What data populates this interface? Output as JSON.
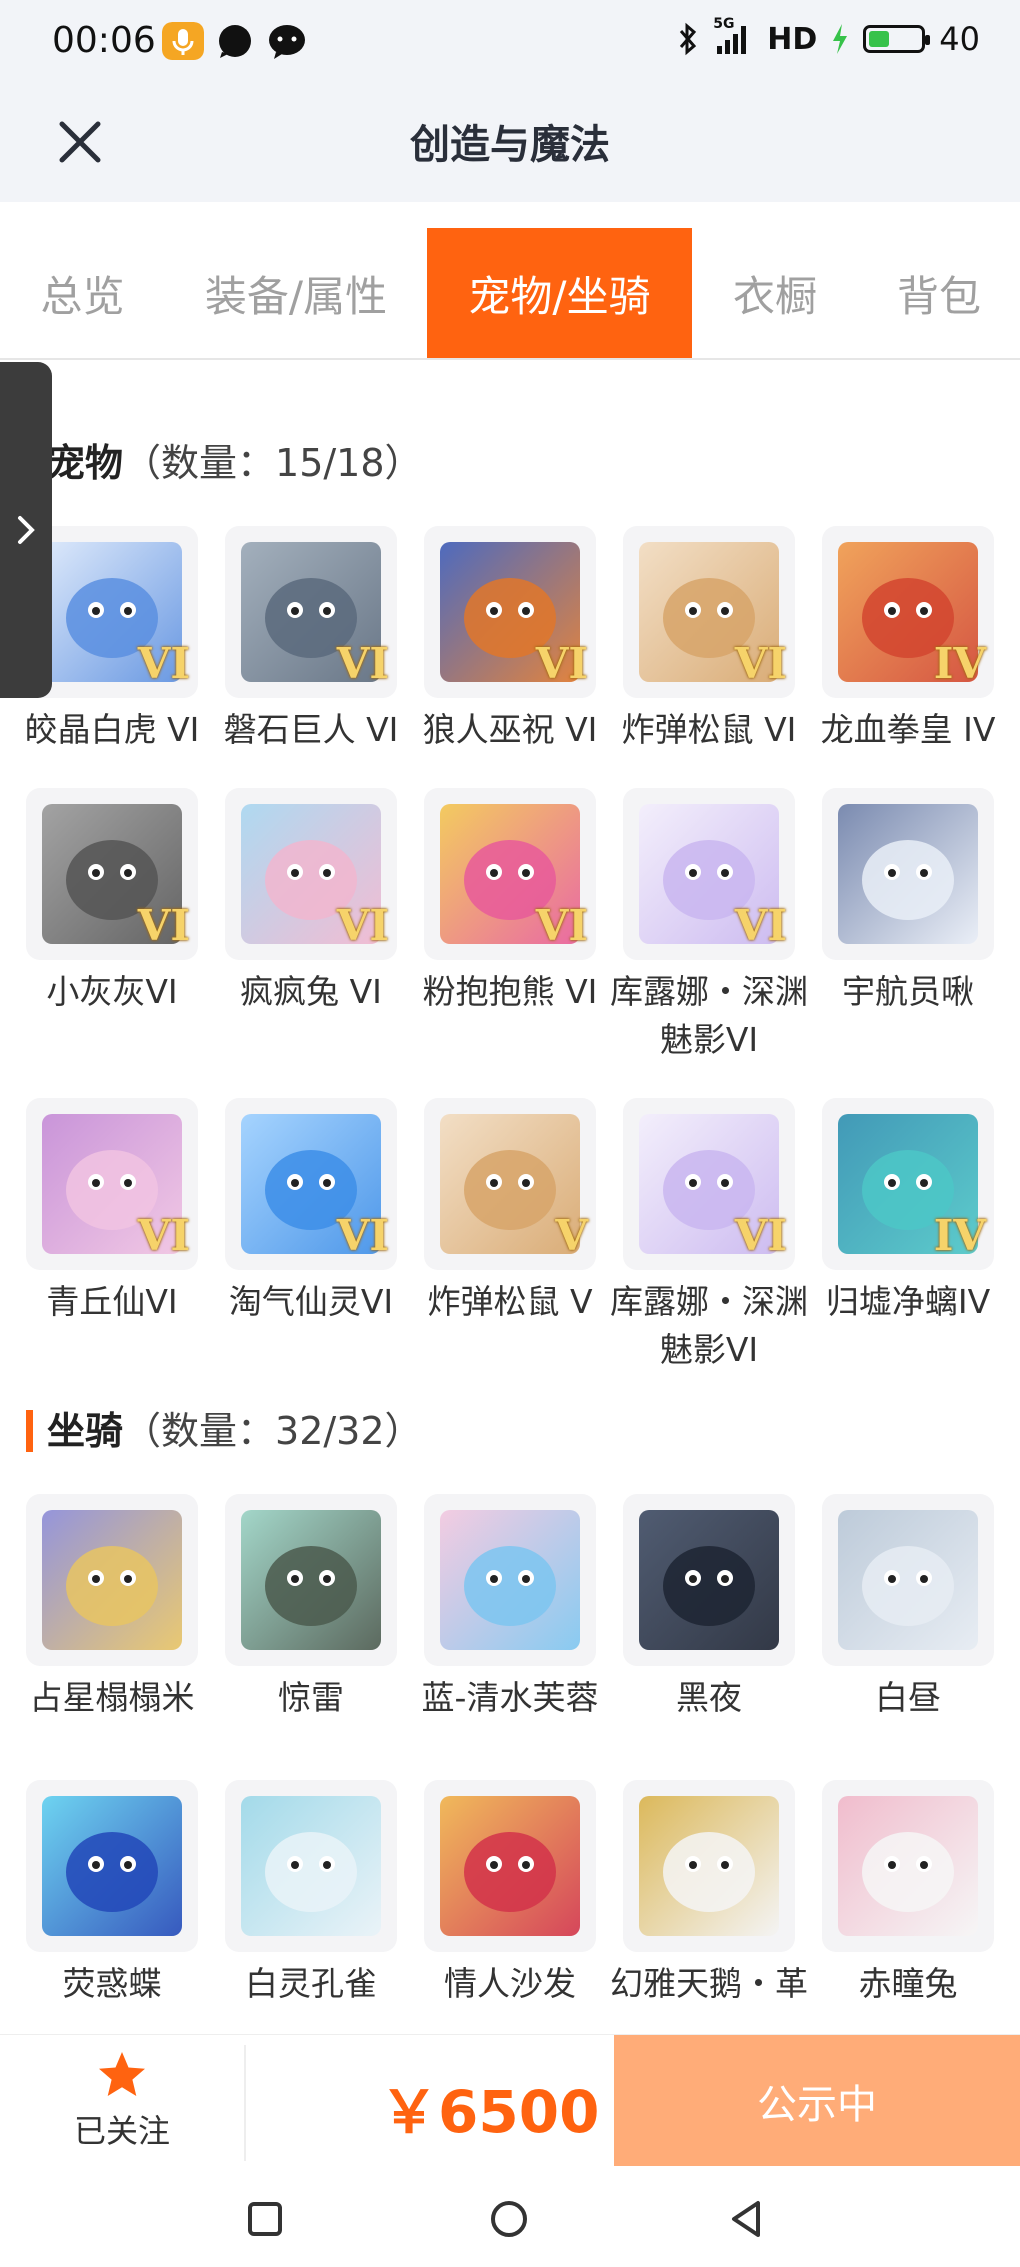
{
  "status_bar": {
    "time": "00:06",
    "network": "5G",
    "hd": "HD",
    "battery": "40",
    "battery_level": 0.4
  },
  "header": {
    "title": "创造与魔法"
  },
  "tabs": [
    {
      "label": "总览",
      "active": false
    },
    {
      "label": "装备/属性",
      "active": false
    },
    {
      "label": "宠物/坐骑",
      "active": true
    },
    {
      "label": "衣橱",
      "active": false
    },
    {
      "label": "背包",
      "active": false
    }
  ],
  "pets": {
    "title": "宠物",
    "count": "（数量：15/18）",
    "items": [
      {
        "name": "皎晶白虎 VI",
        "badge": "VI"
      },
      {
        "name": "磐石巨人 VI",
        "badge": "VI"
      },
      {
        "name": "狼人巫祝 VI",
        "badge": "VI"
      },
      {
        "name": "炸弹松鼠 VI",
        "badge": "VI"
      },
      {
        "name": "龙血拳皇 IV",
        "badge": "IV"
      },
      {
        "name": "小灰灰VI",
        "badge": "VI"
      },
      {
        "name": "疯疯兔 VI",
        "badge": "VI"
      },
      {
        "name": "粉抱抱熊 VI",
        "badge": "VI"
      },
      {
        "name": "库露娜・深渊魅影VI",
        "badge": "VI"
      },
      {
        "name": "宇航员啾",
        "badge": ""
      },
      {
        "name": "青丘仙VI",
        "badge": "VI"
      },
      {
        "name": "淘气仙灵VI",
        "badge": "VI"
      },
      {
        "name": "炸弹松鼠 V",
        "badge": "V"
      },
      {
        "name": "库露娜・深渊魅影VI",
        "badge": "VI"
      },
      {
        "name": "归墟净螭IV",
        "badge": "IV"
      }
    ]
  },
  "mounts": {
    "title": "坐骑",
    "count": "（数量：32/32）",
    "items": [
      {
        "name": "占星榻榻米"
      },
      {
        "name": "惊雷"
      },
      {
        "name": "蓝-清水芙蓉"
      },
      {
        "name": "黑夜"
      },
      {
        "name": "白昼"
      },
      {
        "name": "荧惑蝶"
      },
      {
        "name": "白灵孔雀"
      },
      {
        "name": "情人沙发"
      },
      {
        "name": "幻雅天鹅・革"
      },
      {
        "name": "赤瞳兔"
      }
    ]
  },
  "bottom_bar": {
    "follow_label": "已关注",
    "price": "￥6500",
    "cta_label": "公示中"
  },
  "colors": {
    "accent": "#ff6310",
    "cta_bg": "#ffac78",
    "header_bg": "#f2f4f8"
  },
  "icons": {
    "close": "close-icon",
    "drawer": "chevron-right-icon",
    "follow": "star-icon",
    "nav": [
      "square-icon",
      "circle-icon",
      "back-triangle-icon"
    ]
  }
}
